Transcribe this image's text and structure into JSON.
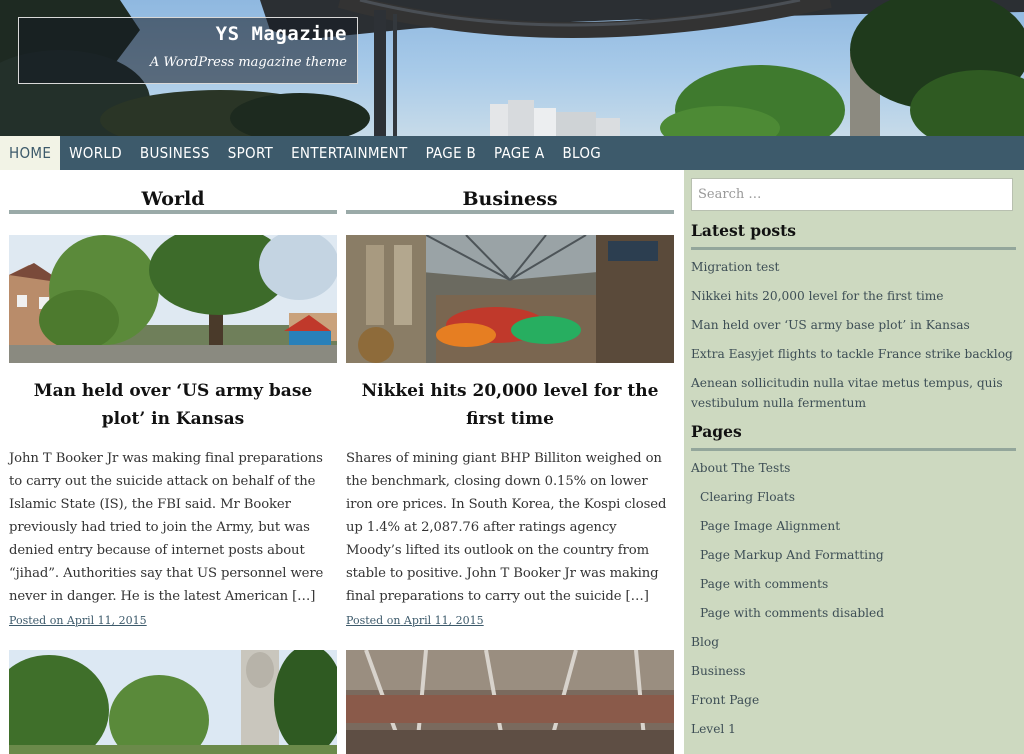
{
  "site": {
    "title": "YS Magazine",
    "tagline": "A WordPress magazine theme"
  },
  "nav": {
    "items": [
      {
        "label": "HOME",
        "active": true
      },
      {
        "label": "WORLD",
        "active": false
      },
      {
        "label": "BUSINESS",
        "active": false
      },
      {
        "label": "SPORT",
        "active": false
      },
      {
        "label": "ENTERTAINMENT",
        "active": false
      },
      {
        "label": "PAGE B",
        "active": false
      },
      {
        "label": "PAGE A",
        "active": false
      },
      {
        "label": "BLOG",
        "active": false
      }
    ]
  },
  "columns": [
    {
      "heading": "World",
      "post": {
        "image": "street-with-trees-photo",
        "title": "Man held over ‘US army base plot’ in Kansas",
        "excerpt": "John T Booker Jr was making final preparations to carry out the suicide attack on behalf of the Islamic State (IS), the FBI said. Mr Booker previously had tried to join the Army, but was denied entry because of internet posts about “jihad”. Authorities say that US personnel were never in danger. He is the latest American […]",
        "meta_prefix": "Posted on",
        "date": "April 11, 2015"
      }
    },
    {
      "heading": "Business",
      "post": {
        "image": "market-hall-photo",
        "title": "Nikkei hits 20,000 level for the first time",
        "excerpt": "Shares of mining giant BHP Billiton weighed on the benchmark, closing down 0.15% on lower iron ore prices. In South Korea, the Kospi closed up 1.4% at 2,087.76 after ratings agency Moody’s lifted its outlook on the country from stable to positive. John T Booker Jr was making final preparations to carry out the suicide […]",
        "meta_prefix": "Posted on",
        "date": "April 11, 2015"
      }
    }
  ],
  "sidebar": {
    "search_placeholder": "Search …",
    "latest_posts_title": "Latest posts",
    "latest_posts": [
      "Migration test",
      "Nikkei hits 20,000 level for the first time",
      "Man held over ‘US army base plot’ in Kansas",
      "Extra Easyjet flights to tackle France strike backlog",
      "Aenean sollicitudin nulla vitae metus tempus, quis vestibulum nulla fermentum"
    ],
    "pages_title": "Pages",
    "pages": [
      {
        "label": "About The Tests",
        "child": false
      },
      {
        "label": "Clearing Floats",
        "child": true
      },
      {
        "label": "Page Image Alignment",
        "child": true
      },
      {
        "label": "Page Markup And Formatting",
        "child": true
      },
      {
        "label": "Page with comments",
        "child": true
      },
      {
        "label": "Page with comments disabled",
        "child": true
      },
      {
        "label": "Blog",
        "child": false
      },
      {
        "label": "Business",
        "child": false
      },
      {
        "label": "Front Page",
        "child": false
      },
      {
        "label": "Level 1",
        "child": false
      }
    ]
  },
  "colors": {
    "nav_bg": "#3d5a6b",
    "nav_active_bg": "#f2f3e6",
    "sidebar_bg": "#cdd9c0",
    "heading_rule": "#9aaaa8"
  }
}
